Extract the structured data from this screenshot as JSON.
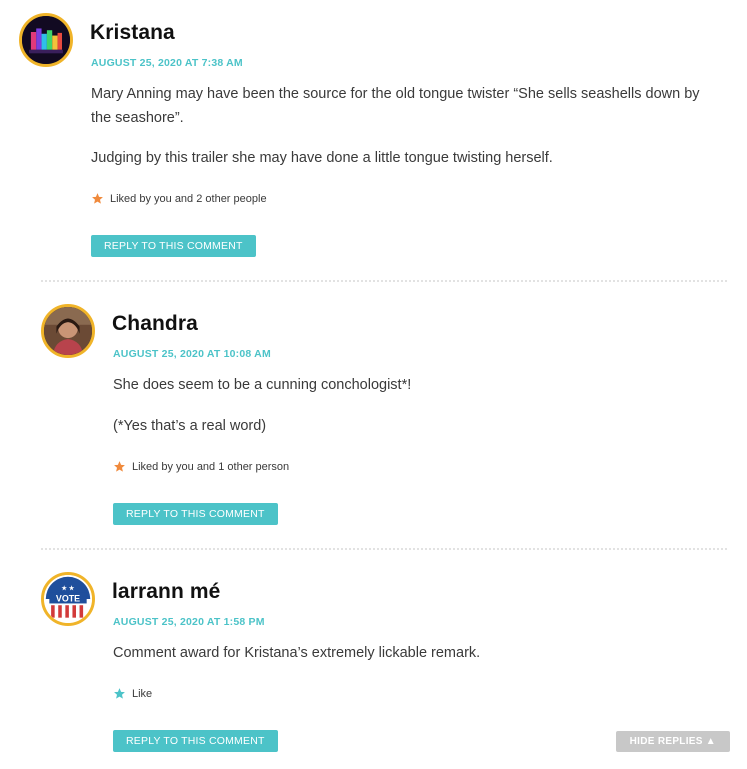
{
  "comments": [
    {
      "author": "Kristana",
      "date": "AUGUST 25, 2020 AT 7:38 AM",
      "paragraphs": [
        "Mary Anning may have been the source for the old tongue twister “She sells seashells down by the seashore”.",
        "Judging by this trailer she may have done a little tongue twisting herself."
      ],
      "likes": "Liked by you and 2 other people",
      "like_icon_color": "#f08a3c",
      "reply_label": "REPLY TO THIS COMMENT"
    },
    {
      "author": "Chandra",
      "date": "AUGUST 25, 2020 AT 10:08 AM",
      "paragraphs": [
        "She does seem to be a cunning conchologist*!",
        "(*Yes that’s a real word)"
      ],
      "likes": "Liked by you and 1 other person",
      "like_icon_color": "#f08a3c",
      "reply_label": "REPLY TO THIS COMMENT"
    },
    {
      "author": "larrann mé",
      "date": "AUGUST 25, 2020 AT 1:58 PM",
      "paragraphs": [
        "Comment award for Kristana’s extremely lickable remark."
      ],
      "likes": "Like",
      "like_icon_color": "#4cc3c8",
      "reply_label": "REPLY TO THIS COMMENT",
      "avatar_text": "VOTE"
    }
  ],
  "hide_replies_label": "HIDE REPLIES ▲",
  "colors": {
    "accent": "#4cc3c8",
    "avatar_border": "#f0b429",
    "liked_star": "#f08a3c",
    "hide_replies_bg": "#c8c8c8"
  }
}
